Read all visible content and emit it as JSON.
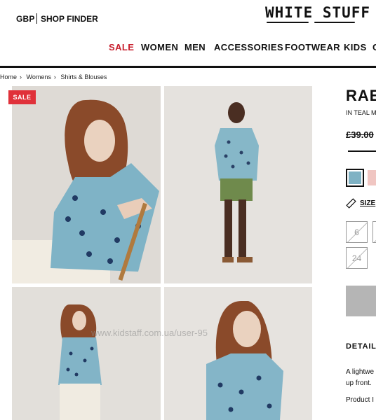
{
  "header": {
    "currency": "GBP",
    "shop_finder": "SHOP FINDER",
    "logo": "WHITE STUFF",
    "nav": [
      "SALE",
      "WOMEN",
      "MEN",
      "ACCESSORIES",
      "FOOTWEAR",
      "KIDS",
      "C"
    ]
  },
  "breadcrumb": [
    "Home",
    "Womens",
    "Shirts & Blouses"
  ],
  "gallery": {
    "badge": "SALE"
  },
  "product": {
    "title": "RAE",
    "colour": "IN TEAL MU",
    "price": "£39.00",
    "size_guide": "SIZE",
    "sizes": [
      "6",
      "24"
    ],
    "details_heading": "DETAILS",
    "description_lines": [
      "A lightwe",
      "up front."
    ],
    "product_label": "Product I"
  },
  "watermark": "www.kidstaff.com.ua/user-95"
}
